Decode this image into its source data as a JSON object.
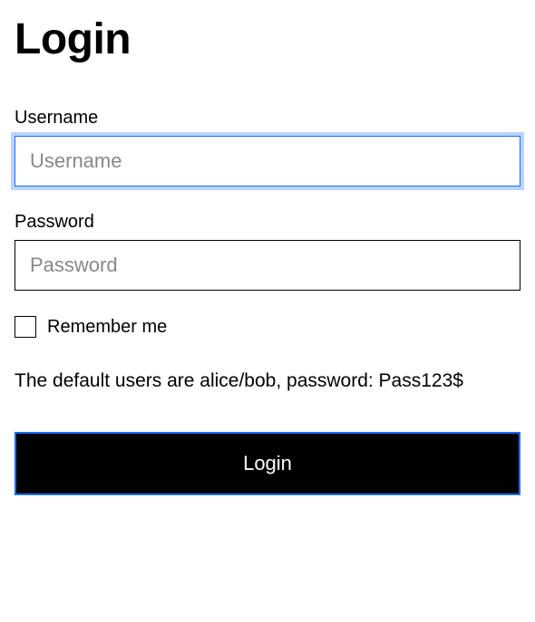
{
  "title": "Login",
  "fields": {
    "username": {
      "label": "Username",
      "placeholder": "Username",
      "value": ""
    },
    "password": {
      "label": "Password",
      "placeholder": "Password",
      "value": ""
    }
  },
  "remember": {
    "label": "Remember me",
    "checked": false
  },
  "helper_text": "The default users are alice/bob, password: Pass123$",
  "submit_label": "Login"
}
